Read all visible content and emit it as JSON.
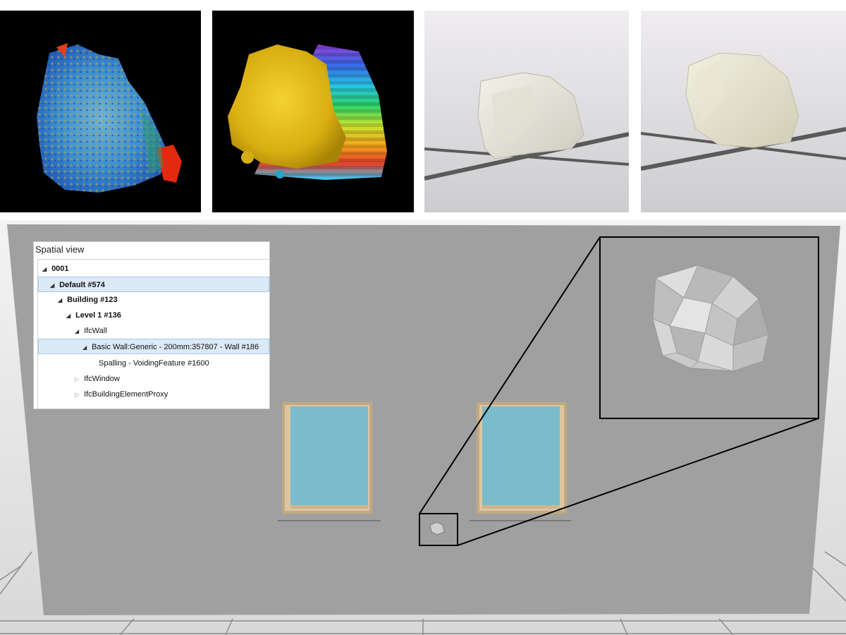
{
  "tree": {
    "title": "Spatial view",
    "items": [
      {
        "label": "0001",
        "twisty": "◢"
      },
      {
        "label": "Default #574",
        "twisty": "◢"
      },
      {
        "label": "Building #123",
        "twisty": "◢"
      },
      {
        "label": "Level 1 #136",
        "twisty": "◢"
      },
      {
        "label": "IfcWall",
        "twisty": "◢"
      },
      {
        "label": "Basic Wall:Generic - 200mm:357807 - Wall #186",
        "twisty": "◢"
      },
      {
        "label": "Spalling - VoidingFeature #1600",
        "twisty": ""
      },
      {
        "label": "IfcWindow",
        "twisty": "▷"
      },
      {
        "label": "IfcBuildingElementProxy",
        "twisty": "▷"
      }
    ]
  },
  "colors": {
    "wall": "#a0a0a0",
    "glass": "#7bbccc",
    "frame": "#d9c3a0",
    "grid_line": "#5c5c5c",
    "mesh_yellow": "#e6c21a"
  }
}
